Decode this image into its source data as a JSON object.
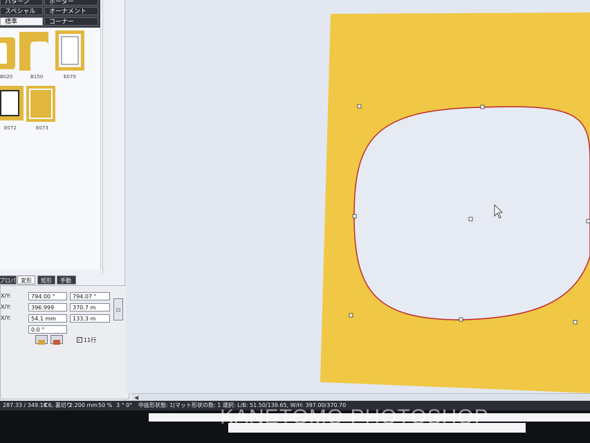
{
  "left_panel": {
    "tabs": [
      {
        "label": "パターン"
      },
      {
        "label": "ボーダー"
      },
      {
        "label": "スペシャル"
      },
      {
        "label": "オーナメント"
      },
      {
        "label": "標準"
      },
      {
        "label": "コーナー"
      }
    ],
    "thumbnails": [
      {
        "label": "B020"
      },
      {
        "label": "B150"
      },
      {
        "label": "E070"
      },
      {
        "label": "E072"
      },
      {
        "label": "E073"
      }
    ],
    "props_tabs": [
      {
        "label": "プロパティー"
      },
      {
        "label": "変形"
      },
      {
        "label": "矩形"
      },
      {
        "label": "手動"
      }
    ],
    "props": {
      "row1": {
        "label": "X/Y:",
        "v1": "794.00 ° ",
        "v2": "794.07 ° "
      },
      "row2": {
        "label": "X/Y:",
        "v1": "396.999",
        "v2": "370.7 m"
      },
      "row3": {
        "label": "X/Y:",
        "v1": "54.1 mm",
        "v2": "133.3 m"
      },
      "row4": {
        "label": "",
        "v1": "0.0 °"
      },
      "check_label": "11行",
      "lock": "ロ"
    }
  },
  "status": {
    "coords": "287.33 / 349.18",
    "mode": "C6, 裏切り",
    "size": "2.200 mm",
    "zoom": "50 %",
    "angle": "3 °  0°",
    "message": "中抜形状態: 1|マット形状の数: 1  選択: L/B: 51.50/139.65, W/H: 397.00/370.70"
  },
  "watermark": "KANETOMO PHOTOSHOP",
  "colors": {
    "mat": "#f0c845",
    "opening": "#e6eaf3",
    "outline": "#c0282a",
    "frame_gold": "#e2b73d"
  }
}
